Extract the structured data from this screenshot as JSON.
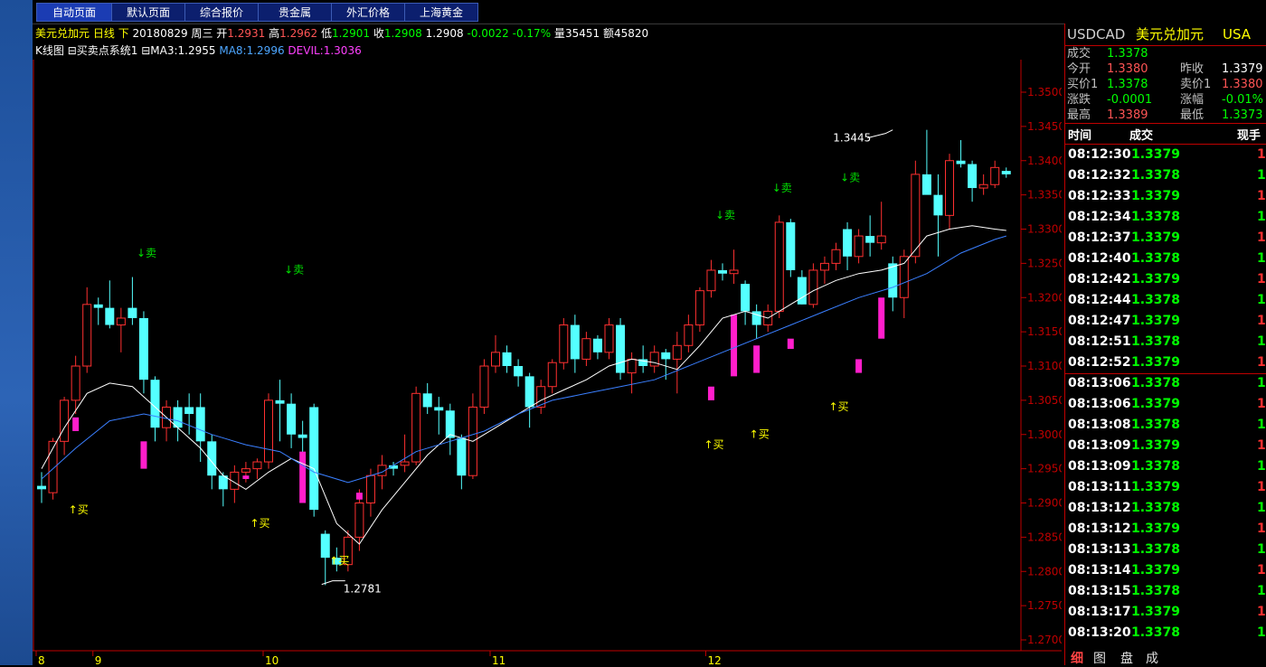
{
  "tabs": [
    {
      "label": "自动页面",
      "active": true
    },
    {
      "label": "默认页面",
      "active": false
    },
    {
      "label": "综合报价",
      "active": false
    },
    {
      "label": "贵金属",
      "active": false
    },
    {
      "label": "外汇价格",
      "active": false
    },
    {
      "label": "上海黄金",
      "active": false
    }
  ],
  "quote": {
    "name": "美元兑加元",
    "period": "日线",
    "arrow": "下",
    "date": "20180829",
    "weekday": "周三",
    "open_label": "开",
    "open": "1.2931",
    "high_label": "高",
    "high": "1.2962",
    "low_label": "低",
    "low": "1.2901",
    "close_label": "收",
    "close": "1.2908",
    "last": "1.2908",
    "change": "-0.0022",
    "change_pct": "-0.17%",
    "vol_label": "量",
    "vol": "35451",
    "amt_label": "额",
    "amt": "45820"
  },
  "indicators": {
    "chart_label": "K线图",
    "system": "买卖点系统1",
    "ma3": "MA3:1.2955",
    "ma8": "MA8:1.2996",
    "devil": "DEVIL:1.3036"
  },
  "chart_data": {
    "type": "candlestick",
    "ylim": [
      1.27,
      1.35
    ],
    "yticks": [
      "1.3500",
      "1.3450",
      "1.3400",
      "1.3350",
      "1.3300",
      "1.3250",
      "1.3200",
      "1.3150",
      "1.3100",
      "1.3050",
      "1.3000",
      "1.2950",
      "1.2900",
      "1.2850",
      "1.2800",
      "1.2750",
      "1.2700"
    ],
    "xticks": [
      {
        "label": "8",
        "i": 0
      },
      {
        "label": "9",
        "i": 5
      },
      {
        "label": "10",
        "i": 20
      },
      {
        "label": "11",
        "i": 40
      },
      {
        "label": "12",
        "i": 59
      }
    ],
    "candles": [
      [
        1.2925,
        1.2945,
        1.29,
        1.292
      ],
      [
        1.2915,
        1.2995,
        1.2905,
        1.299
      ],
      [
        1.299,
        1.3055,
        1.297,
        1.305
      ],
      [
        1.305,
        1.3115,
        1.303,
        1.31
      ],
      [
        1.31,
        1.3215,
        1.309,
        1.319
      ],
      [
        1.319,
        1.32,
        1.316,
        1.3185
      ],
      [
        1.3185,
        1.3225,
        1.3155,
        1.316
      ],
      [
        1.316,
        1.3185,
        1.312,
        1.317
      ],
      [
        1.3185,
        1.323,
        1.316,
        1.317
      ],
      [
        1.317,
        1.318,
        1.306,
        1.308
      ],
      [
        1.308,
        1.3085,
        1.299,
        1.301
      ],
      [
        1.301,
        1.305,
        1.299,
        1.304
      ],
      [
        1.304,
        1.305,
        1.299,
        1.301
      ],
      [
        1.304,
        1.306,
        1.3,
        1.303
      ],
      [
        1.304,
        1.306,
        1.296,
        1.299
      ],
      [
        1.299,
        1.3,
        1.292,
        1.294
      ],
      [
        1.294,
        1.2945,
        1.2895,
        1.292
      ],
      [
        1.292,
        1.2955,
        1.29,
        1.2945
      ],
      [
        1.2945,
        1.296,
        1.293,
        1.295
      ],
      [
        1.295,
        1.2965,
        1.2935,
        1.296
      ],
      [
        1.296,
        1.306,
        1.295,
        1.305
      ],
      [
        1.305,
        1.308,
        1.299,
        1.3045
      ],
      [
        1.3045,
        1.306,
        1.298,
        1.3
      ],
      [
        1.3,
        1.302,
        1.296,
        1.2995
      ],
      [
        1.304,
        1.3045,
        1.288,
        1.289
      ],
      [
        1.2855,
        1.286,
        1.278,
        1.282
      ],
      [
        1.282,
        1.2835,
        1.28,
        1.281
      ],
      [
        1.281,
        1.286,
        1.28,
        1.285
      ],
      [
        1.285,
        1.292,
        1.283,
        1.29
      ],
      [
        1.29,
        1.295,
        1.288,
        1.294
      ],
      [
        1.294,
        1.297,
        1.292,
        1.2955
      ],
      [
        1.2955,
        1.296,
        1.294,
        1.295
      ],
      [
        1.2955,
        1.3,
        1.2945,
        1.296
      ],
      [
        1.296,
        1.307,
        1.2955,
        1.306
      ],
      [
        1.306,
        1.3075,
        1.303,
        1.304
      ],
      [
        1.304,
        1.3055,
        1.3,
        1.3035
      ],
      [
        1.3035,
        1.3045,
        1.297,
        1.2995
      ],
      [
        1.2995,
        1.3,
        1.292,
        1.294
      ],
      [
        1.294,
        1.306,
        1.2935,
        1.304
      ],
      [
        1.304,
        1.311,
        1.303,
        1.31
      ],
      [
        1.31,
        1.3145,
        1.309,
        1.312
      ],
      [
        1.312,
        1.313,
        1.309,
        1.31
      ],
      [
        1.31,
        1.311,
        1.307,
        1.3085
      ],
      [
        1.3085,
        1.309,
        1.301,
        1.304
      ],
      [
        1.304,
        1.308,
        1.303,
        1.307
      ],
      [
        1.307,
        1.311,
        1.306,
        1.3105
      ],
      [
        1.3105,
        1.317,
        1.3095,
        1.316
      ],
      [
        1.316,
        1.3175,
        1.309,
        1.311
      ],
      [
        1.311,
        1.315,
        1.31,
        1.314
      ],
      [
        1.314,
        1.3145,
        1.311,
        1.312
      ],
      [
        1.312,
        1.317,
        1.311,
        1.316
      ],
      [
        1.316,
        1.317,
        1.308,
        1.309
      ],
      [
        1.309,
        1.312,
        1.306,
        1.311
      ],
      [
        1.311,
        1.313,
        1.309,
        1.31
      ],
      [
        1.31,
        1.313,
        1.309,
        1.312
      ],
      [
        1.312,
        1.3125,
        1.308,
        1.311
      ],
      [
        1.311,
        1.315,
        1.306,
        1.313
      ],
      [
        1.313,
        1.3175,
        1.312,
        1.316
      ],
      [
        1.316,
        1.3215,
        1.315,
        1.321
      ],
      [
        1.321,
        1.3255,
        1.32,
        1.324
      ],
      [
        1.324,
        1.325,
        1.3225,
        1.3235
      ],
      [
        1.3235,
        1.327,
        1.322,
        1.324
      ],
      [
        1.322,
        1.3225,
        1.316,
        1.318
      ],
      [
        1.318,
        1.319,
        1.314,
        1.316
      ],
      [
        1.316,
        1.319,
        1.315,
        1.318
      ],
      [
        1.318,
        1.332,
        1.317,
        1.331
      ],
      [
        1.331,
        1.3315,
        1.323,
        1.324
      ],
      [
        1.323,
        1.324,
        1.319,
        1.319
      ],
      [
        1.319,
        1.325,
        1.3185,
        1.324
      ],
      [
        1.324,
        1.326,
        1.322,
        1.325
      ],
      [
        1.325,
        1.328,
        1.324,
        1.327
      ],
      [
        1.33,
        1.331,
        1.324,
        1.326
      ],
      [
        1.326,
        1.33,
        1.325,
        1.329
      ],
      [
        1.329,
        1.332,
        1.326,
        1.328
      ],
      [
        1.328,
        1.334,
        1.327,
        1.329
      ],
      [
        1.325,
        1.326,
        1.318,
        1.32
      ],
      [
        1.32,
        1.327,
        1.317,
        1.326
      ],
      [
        1.326,
        1.34,
        1.325,
        1.338
      ],
      [
        1.338,
        1.3445,
        1.336,
        1.335
      ],
      [
        1.335,
        1.338,
        1.326,
        1.332
      ],
      [
        1.332,
        1.341,
        1.33,
        1.34
      ],
      [
        1.34,
        1.343,
        1.339,
        1.3395
      ],
      [
        1.3395,
        1.34,
        1.334,
        1.336
      ],
      [
        1.336,
        1.338,
        1.335,
        1.3365
      ],
      [
        1.3365,
        1.34,
        1.336,
        1.339
      ],
      [
        1.3385,
        1.339,
        1.3375,
        1.338
      ]
    ],
    "ma_white": [
      [
        0,
        1.295
      ],
      [
        2,
        1.301
      ],
      [
        4,
        1.306
      ],
      [
        6,
        1.3075
      ],
      [
        8,
        1.307
      ],
      [
        10,
        1.304
      ],
      [
        12,
        1.301
      ],
      [
        14,
        1.298
      ],
      [
        16,
        1.294
      ],
      [
        18,
        1.292
      ],
      [
        20,
        1.2945
      ],
      [
        22,
        1.2965
      ],
      [
        24,
        1.295
      ],
      [
        26,
        1.287
      ],
      [
        28,
        1.284
      ],
      [
        30,
        1.289
      ],
      [
        32,
        1.293
      ],
      [
        34,
        1.297
      ],
      [
        36,
        1.3
      ],
      [
        38,
        1.299
      ],
      [
        40,
        1.301
      ],
      [
        42,
        1.303
      ],
      [
        44,
        1.305
      ],
      [
        46,
        1.3065
      ],
      [
        48,
        1.308
      ],
      [
        50,
        1.31
      ],
      [
        52,
        1.311
      ],
      [
        54,
        1.3105
      ],
      [
        56,
        1.3095
      ],
      [
        58,
        1.313
      ],
      [
        60,
        1.317
      ],
      [
        62,
        1.318
      ],
      [
        64,
        1.317
      ],
      [
        66,
        1.319
      ],
      [
        68,
        1.321
      ],
      [
        70,
        1.3225
      ],
      [
        72,
        1.3235
      ],
      [
        74,
        1.324
      ],
      [
        76,
        1.325
      ],
      [
        78,
        1.329
      ],
      [
        80,
        1.33
      ],
      [
        82,
        1.3305
      ],
      [
        84,
        1.33
      ],
      [
        85,
        1.3298
      ]
    ],
    "ma_blue": [
      [
        0,
        1.2935
      ],
      [
        3,
        1.298
      ],
      [
        6,
        1.302
      ],
      [
        9,
        1.303
      ],
      [
        12,
        1.302
      ],
      [
        15,
        1.3
      ],
      [
        18,
        1.2985
      ],
      [
        21,
        1.2975
      ],
      [
        24,
        1.2945
      ],
      [
        27,
        1.293
      ],
      [
        30,
        1.2945
      ],
      [
        33,
        1.2975
      ],
      [
        36,
        1.299
      ],
      [
        39,
        1.3005
      ],
      [
        42,
        1.303
      ],
      [
        45,
        1.305
      ],
      [
        48,
        1.306
      ],
      [
        51,
        1.307
      ],
      [
        54,
        1.308
      ],
      [
        57,
        1.31
      ],
      [
        60,
        1.312
      ],
      [
        63,
        1.314
      ],
      [
        66,
        1.316
      ],
      [
        69,
        1.318
      ],
      [
        72,
        1.32
      ],
      [
        75,
        1.3215
      ],
      [
        78,
        1.3235
      ],
      [
        81,
        1.3265
      ],
      [
        84,
        1.3285
      ],
      [
        85,
        1.329
      ]
    ],
    "devil_bars": [
      [
        3,
        1.3005,
        1.3025
      ],
      [
        9,
        1.295,
        1.299
      ],
      [
        18,
        1.2935,
        1.294
      ],
      [
        23,
        1.29,
        1.2975
      ],
      [
        28,
        1.2905,
        1.2915
      ],
      [
        59,
        1.305,
        1.307
      ],
      [
        61,
        1.3085,
        1.3175
      ],
      [
        63,
        1.309,
        1.313
      ],
      [
        66,
        1.3125,
        1.314
      ],
      [
        72,
        1.309,
        1.311
      ],
      [
        74,
        1.314,
        1.32
      ]
    ],
    "signals": [
      {
        "text": "↓卖",
        "i": 9,
        "y": 1.326,
        "kind": "sell"
      },
      {
        "text": "↓卖",
        "i": 22,
        "y": 1.3235,
        "kind": "sell"
      },
      {
        "text": "↓卖",
        "i": 60,
        "y": 1.3315,
        "kind": "sell"
      },
      {
        "text": "↓卖",
        "i": 65,
        "y": 1.3355,
        "kind": "sell"
      },
      {
        "text": "↓卖",
        "i": 71,
        "y": 1.337,
        "kind": "sell"
      },
      {
        "text": "↑买",
        "i": 3,
        "y": 1.2885,
        "kind": "buy"
      },
      {
        "text": "↑买",
        "i": 19,
        "y": 1.2865,
        "kind": "buy"
      },
      {
        "text": "↑买",
        "i": 26,
        "y": 1.281,
        "kind": "buy"
      },
      {
        "text": "↑买",
        "i": 59,
        "y": 1.298,
        "kind": "buy"
      },
      {
        "text": "↑买",
        "i": 63,
        "y": 1.2995,
        "kind": "buy"
      },
      {
        "text": "↑买",
        "i": 70,
        "y": 1.3035,
        "kind": "buy"
      }
    ],
    "annotations": [
      {
        "text": "1.3445",
        "i": 75,
        "y": 1.3445
      },
      {
        "text": "1.2781",
        "i": 25,
        "y": 1.2781
      }
    ]
  },
  "panel": {
    "symbol": "USDCAD",
    "name": "美元兑加元",
    "market": "USA",
    "rows": [
      {
        "l1": "成交",
        "v1": "1.3378",
        "c1": "g"
      },
      {
        "l1": "今开",
        "v1": "1.3380",
        "c1": "r",
        "l2": "昨收",
        "v2": "1.3379",
        "c2": "w"
      },
      {
        "l1": "买价1",
        "v1": "1.3378",
        "c1": "g",
        "l2": "卖价1",
        "v2": "1.3380",
        "c2": "r"
      },
      {
        "l1": "涨跌",
        "v1": "-0.0001",
        "c1": "g",
        "l2": "涨幅",
        "v2": "-0.01%",
        "c2": "g"
      },
      {
        "l1": "最高",
        "v1": "1.3389",
        "c1": "r",
        "l2": "最低",
        "v2": "1.3373",
        "c2": "g"
      }
    ],
    "headers": {
      "time": "时间",
      "price": "成交",
      "qty": "现手"
    },
    "ticks": [
      {
        "t": "08:12:30",
        "p": "1.3379",
        "q": "1",
        "qc": "r"
      },
      {
        "t": "08:12:32",
        "p": "1.3378",
        "q": "1",
        "qc": "g"
      },
      {
        "t": "08:12:33",
        "p": "1.3379",
        "q": "1",
        "qc": "r"
      },
      {
        "t": "08:12:34",
        "p": "1.3378",
        "q": "1",
        "qc": "g"
      },
      {
        "t": "08:12:37",
        "p": "1.3379",
        "q": "1",
        "qc": "r"
      },
      {
        "t": "08:12:40",
        "p": "1.3378",
        "q": "1",
        "qc": "g"
      },
      {
        "t": "08:12:42",
        "p": "1.3379",
        "q": "1",
        "qc": "r"
      },
      {
        "t": "08:12:44",
        "p": "1.3378",
        "q": "1",
        "qc": "g"
      },
      {
        "t": "08:12:47",
        "p": "1.3379",
        "q": "1",
        "qc": "r"
      },
      {
        "t": "08:12:51",
        "p": "1.3378",
        "q": "1",
        "qc": "g"
      },
      {
        "t": "08:12:52",
        "p": "1.3379",
        "q": "1",
        "qc": "r"
      },
      {
        "t": "08:13:06",
        "p": "1.3378",
        "q": "1",
        "qc": "g"
      },
      {
        "t": "08:13:06",
        "p": "1.3379",
        "q": "1",
        "qc": "r"
      },
      {
        "t": "08:13:08",
        "p": "1.3378",
        "q": "1",
        "qc": "g"
      },
      {
        "t": "08:13:09",
        "p": "1.3379",
        "q": "1",
        "qc": "r"
      },
      {
        "t": "08:13:09",
        "p": "1.3378",
        "q": "1",
        "qc": "g"
      },
      {
        "t": "08:13:11",
        "p": "1.3379",
        "q": "1",
        "qc": "r"
      },
      {
        "t": "08:13:12",
        "p": "1.3378",
        "q": "1",
        "qc": "g"
      },
      {
        "t": "08:13:12",
        "p": "1.3379",
        "q": "1",
        "qc": "r"
      },
      {
        "t": "08:13:13",
        "p": "1.3378",
        "q": "1",
        "qc": "g"
      },
      {
        "t": "08:13:14",
        "p": "1.3379",
        "q": "1",
        "qc": "r"
      },
      {
        "t": "08:13:15",
        "p": "1.3378",
        "q": "1",
        "qc": "g"
      },
      {
        "t": "08:13:17",
        "p": "1.3379",
        "q": "1",
        "qc": "r"
      },
      {
        "t": "08:13:20",
        "p": "1.3378",
        "q": "1",
        "qc": "g"
      }
    ],
    "bottom_tabs": [
      "细",
      "图",
      "盘",
      "成"
    ]
  },
  "colors": {
    "up": "#ff3030",
    "down": "#54ffff",
    "ma_white": "#ffffff",
    "ma_blue": "#3a7fff",
    "devil": "#ff1ecb",
    "sell": "#00e000",
    "buy": "#ffff00",
    "axis": "#c00000"
  }
}
